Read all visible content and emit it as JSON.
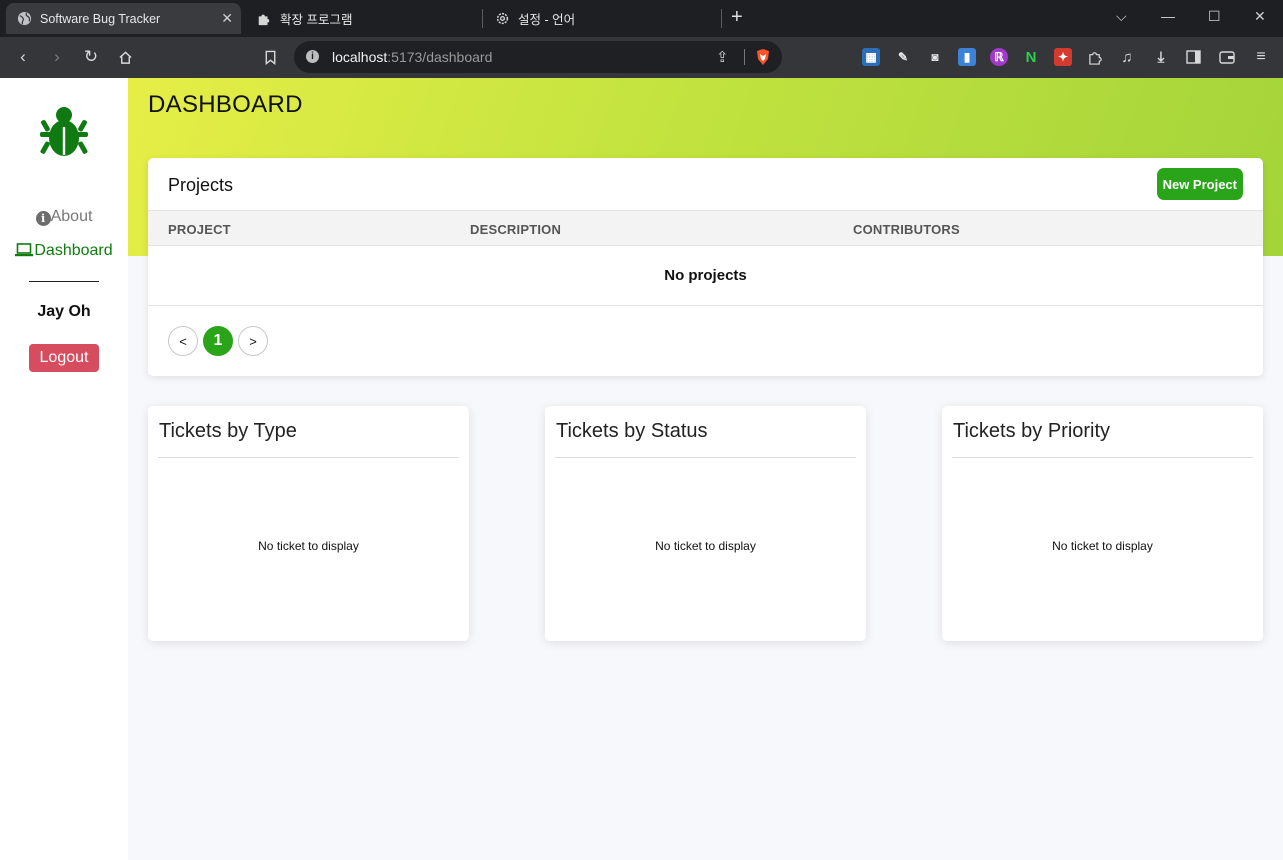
{
  "browser": {
    "tabs": [
      {
        "title": "Software Bug Tracker",
        "icon": "globe-icon",
        "active": true
      },
      {
        "title": "확장 프로그램",
        "icon": "puzzle-icon",
        "active": false
      },
      {
        "title": "설정 - 언어",
        "icon": "gear-icon",
        "active": false
      }
    ],
    "url_host": "localhost",
    "url_rest": ":5173/dashboard"
  },
  "sidebar": {
    "about_label": "About",
    "dashboard_label": "Dashboard",
    "user_name": "Jay Oh",
    "logout_label": "Logout"
  },
  "header": {
    "title": "DASHBOARD"
  },
  "projects": {
    "title": "Projects",
    "new_button": "New Project",
    "columns": [
      "PROJECT",
      "DESCRIPTION",
      "CONTRIBUTORS"
    ],
    "empty_message": "No projects",
    "pagination": {
      "prev": "<",
      "current": "1",
      "next": ">"
    }
  },
  "ticket_cards": [
    {
      "title": "Tickets by Type",
      "empty": "No ticket to display"
    },
    {
      "title": "Tickets by Status",
      "empty": "No ticket to display"
    },
    {
      "title": "Tickets by Priority",
      "empty": "No ticket to display"
    }
  ],
  "colors": {
    "brand_green": "#107b10",
    "button_green": "#2aa51a",
    "logout_red": "#d64d5f",
    "hero_gradient_start": "#e6ee46",
    "hero_gradient_end": "#a4d43a"
  }
}
